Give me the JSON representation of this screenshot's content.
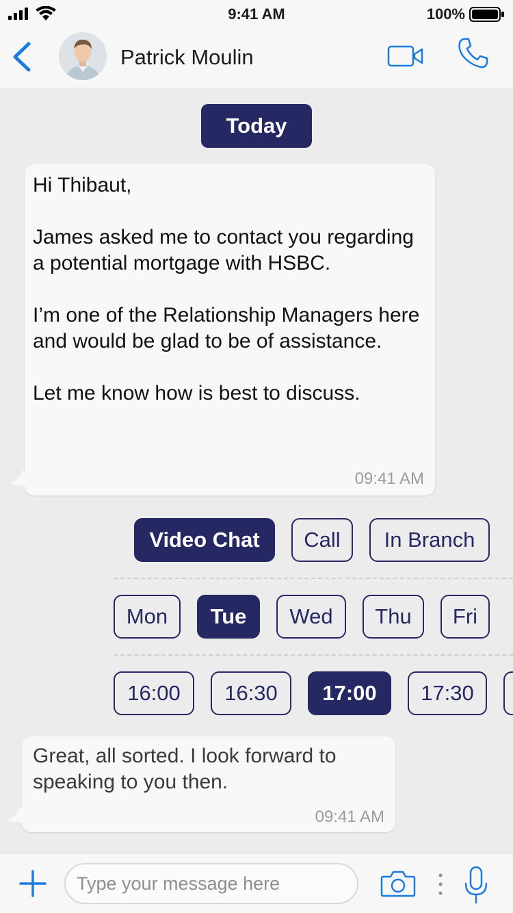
{
  "status_bar": {
    "time": "9:41 AM",
    "battery_percent": "100%",
    "icons": [
      "signal-icon",
      "wifi-icon",
      "battery-icon"
    ]
  },
  "header": {
    "contact_name": "Patrick Moulin",
    "icons": [
      "back-chevron-icon",
      "avatar",
      "video-camera-icon",
      "phone-icon"
    ]
  },
  "date_chip": "Today",
  "messages": [
    {
      "text": "Hi Thibaut,\n\nJames asked me to contact you regarding a potential mortgage with HSBC.\n\nI’m one of the Relationship Managers here and would be glad to be of assistance.\n\nLet me know how is best to discuss.",
      "time": "09:41 AM"
    },
    {
      "text": "Great, all sorted. I look forward to speaking to you then.",
      "time": "09:41 AM"
    }
  ],
  "contact_options": {
    "items": [
      "Video Chat",
      "Call",
      "In Branch"
    ],
    "selected": "Video Chat"
  },
  "days": {
    "items": [
      "Mon",
      "Tue",
      "Wed",
      "Thu",
      "Fri"
    ],
    "selected": "Tue"
  },
  "times": {
    "items": [
      "16:00",
      "16:30",
      "17:00",
      "17:30"
    ],
    "selected": "17:00"
  },
  "composer": {
    "placeholder": "Type your message here",
    "icons": [
      "plus-icon",
      "camera-icon",
      "more-vertical-icon",
      "microphone-icon"
    ]
  },
  "colors": {
    "accent_blue": "#1a7be0",
    "navy": "#252863",
    "background": "#ececed",
    "bubble": "#f9f8f9"
  }
}
